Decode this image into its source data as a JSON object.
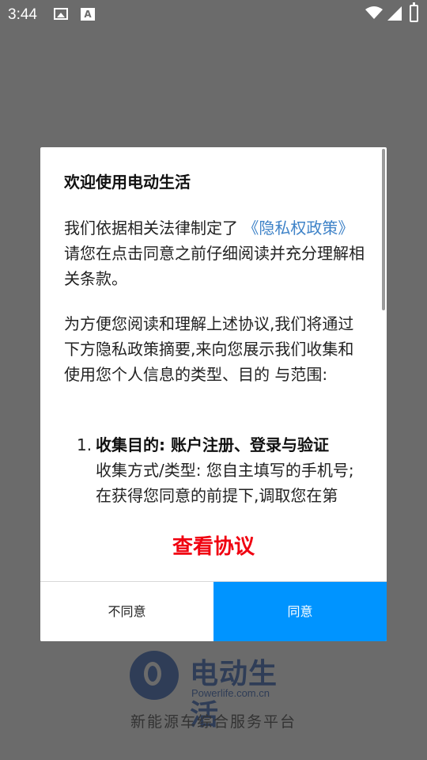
{
  "status_bar": {
    "time": "3:44",
    "icons": [
      "image-icon",
      "a-icon",
      "wifi-icon",
      "signal-icon",
      "battery-icon"
    ]
  },
  "splash": {
    "brand_name": "电动生活",
    "domain": "Powerlife.com.cn",
    "slogan": "新能源车综合服务平台"
  },
  "dialog": {
    "title": "欢迎使用电动生活",
    "p1_before": "我们依据相关法律制定了",
    "p1_link": "《隐私权政策》",
    "p1_after": "请您在点击同意之前仔细阅读并充分理解相关条款。",
    "p2": "为方便您阅读和理解上述协议,我们将通过下方隐私政策摘要,来向您展示我们收集和使用您个人信息的类型、目的 与范围:",
    "list": [
      {
        "number": "1.",
        "heading": "收集目的: 账户注册、登录与验证",
        "line1": "收集方式/类型: 您自主填写的手机号;",
        "line2": "在获得您同意的前提下,调取您在第"
      }
    ],
    "view_agreement": "查看协议",
    "disagree_label": "不同意",
    "agree_label": "同意"
  },
  "colors": {
    "overlay": "#6b6b6b",
    "link": "#3f83c8",
    "agree_button": "#0094ff",
    "view_agreement": "#f00010"
  }
}
